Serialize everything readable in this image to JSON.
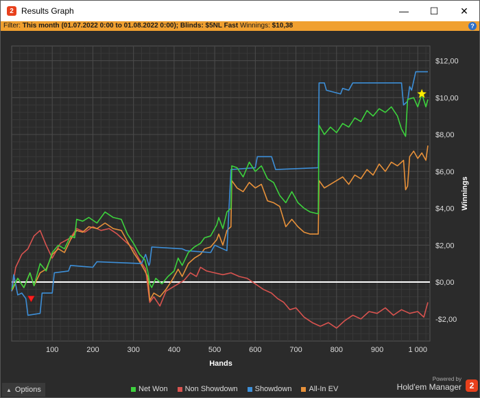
{
  "window": {
    "title": "Results Graph",
    "app_badge": "2",
    "controls": {
      "minimize": "—",
      "maximize": "☐",
      "close": "✕"
    }
  },
  "filter": {
    "prefix": "Filter: ",
    "period": "This month (01.07.2022 0:00 to 01.08.2022 0:00)",
    "sep1": "; ",
    "blinds": "Blinds: $5NL Fast",
    "sep2": " Winnings: ",
    "winnings": "$10,38",
    "help": "?"
  },
  "footer": {
    "options_label": "Options",
    "powered_by": "Powered by",
    "brand": "Hold'em Manager",
    "brand_badge": "2"
  },
  "chart_data": {
    "type": "line",
    "xlabel": "Hands",
    "ylabel": "Winnings",
    "xlim": [
      0,
      1030
    ],
    "ylim": [
      -3.2,
      12.8
    ],
    "x_ticks": [
      100,
      200,
      300,
      400,
      500,
      600,
      700,
      800,
      900,
      1000
    ],
    "x_tick_labels": [
      "100",
      "200",
      "300",
      "400",
      "500",
      "600",
      "700",
      "800",
      "900",
      "1 000"
    ],
    "y_ticks": [
      -2,
      0,
      2,
      4,
      6,
      8,
      10,
      12
    ],
    "y_tick_labels": [
      "-$2,00",
      "$0,00",
      "$2,00",
      "$4,00",
      "$6,00",
      "$8,00",
      "$10,00",
      "$12,00"
    ],
    "grid": true,
    "zero_line": true,
    "legend": {
      "placement": "bottom"
    },
    "markers": [
      {
        "name": "min",
        "x": 48,
        "y": -0.9,
        "shape": "triangle-down",
        "color": "#ff2020"
      },
      {
        "name": "max",
        "x": 1010,
        "y": 10.2,
        "shape": "star",
        "color": "#ffee00"
      }
    ],
    "series": [
      {
        "name": "Net Won",
        "color": "#3dd23d",
        "points": [
          [
            0,
            -0.4
          ],
          [
            15,
            0.2
          ],
          [
            30,
            -0.3
          ],
          [
            45,
            0.5
          ],
          [
            55,
            -0.2
          ],
          [
            70,
            1.0
          ],
          [
            85,
            0.6
          ],
          [
            100,
            1.6
          ],
          [
            115,
            2.0
          ],
          [
            130,
            1.8
          ],
          [
            145,
            2.5
          ],
          [
            155,
            2.4
          ],
          [
            160,
            3.4
          ],
          [
            175,
            3.3
          ],
          [
            190,
            3.5
          ],
          [
            210,
            3.2
          ],
          [
            230,
            3.8
          ],
          [
            250,
            3.5
          ],
          [
            270,
            3.4
          ],
          [
            285,
            2.6
          ],
          [
            300,
            2.1
          ],
          [
            315,
            1.5
          ],
          [
            328,
            1.2
          ],
          [
            335,
            0.6
          ],
          [
            340,
            -0.1
          ],
          [
            345,
            -0.3
          ],
          [
            355,
            0.2
          ],
          [
            370,
            -0.1
          ],
          [
            385,
            0.3
          ],
          [
            400,
            0.6
          ],
          [
            410,
            1.3
          ],
          [
            420,
            0.9
          ],
          [
            435,
            1.6
          ],
          [
            450,
            1.9
          ],
          [
            465,
            2.1
          ],
          [
            475,
            2.4
          ],
          [
            490,
            2.5
          ],
          [
            505,
            3.1
          ],
          [
            510,
            3.5
          ],
          [
            520,
            2.9
          ],
          [
            530,
            3.8
          ],
          [
            540,
            4.0
          ],
          [
            542,
            6.3
          ],
          [
            555,
            6.2
          ],
          [
            570,
            5.7
          ],
          [
            585,
            6.5
          ],
          [
            600,
            6.0
          ],
          [
            615,
            6.3
          ],
          [
            630,
            5.6
          ],
          [
            645,
            5.4
          ],
          [
            660,
            4.7
          ],
          [
            675,
            4.3
          ],
          [
            690,
            4.9
          ],
          [
            705,
            4.3
          ],
          [
            720,
            4.0
          ],
          [
            735,
            3.8
          ],
          [
            755,
            3.7
          ],
          [
            757,
            8.5
          ],
          [
            770,
            8.0
          ],
          [
            785,
            8.4
          ],
          [
            800,
            8.1
          ],
          [
            815,
            8.6
          ],
          [
            830,
            8.4
          ],
          [
            845,
            8.9
          ],
          [
            860,
            8.7
          ],
          [
            875,
            9.3
          ],
          [
            890,
            9.0
          ],
          [
            905,
            9.4
          ],
          [
            920,
            9.2
          ],
          [
            935,
            9.5
          ],
          [
            950,
            9.0
          ],
          [
            960,
            8.3
          ],
          [
            970,
            7.9
          ],
          [
            975,
            9.9
          ],
          [
            990,
            10.0
          ],
          [
            1000,
            9.5
          ],
          [
            1010,
            10.2
          ],
          [
            1020,
            9.5
          ],
          [
            1025,
            9.9
          ]
        ]
      },
      {
        "name": "Non Showdown",
        "color": "#d9534f",
        "points": [
          [
            0,
            -0.5
          ],
          [
            10,
            0.8
          ],
          [
            25,
            1.5
          ],
          [
            40,
            1.8
          ],
          [
            55,
            2.5
          ],
          [
            70,
            2.8
          ],
          [
            85,
            2.0
          ],
          [
            100,
            1.3
          ],
          [
            120,
            2.1
          ],
          [
            145,
            2.4
          ],
          [
            160,
            2.9
          ],
          [
            180,
            2.7
          ],
          [
            200,
            3.0
          ],
          [
            220,
            2.8
          ],
          [
            240,
            2.9
          ],
          [
            260,
            2.6
          ],
          [
            280,
            2.2
          ],
          [
            300,
            1.8
          ],
          [
            315,
            1.2
          ],
          [
            330,
            0.7
          ],
          [
            340,
            -1.1
          ],
          [
            350,
            -0.8
          ],
          [
            365,
            -1.3
          ],
          [
            380,
            -0.5
          ],
          [
            395,
            -0.3
          ],
          [
            410,
            -0.1
          ],
          [
            425,
            0.1
          ],
          [
            440,
            0.5
          ],
          [
            455,
            0.3
          ],
          [
            465,
            0.8
          ],
          [
            480,
            0.6
          ],
          [
            500,
            0.5
          ],
          [
            520,
            0.4
          ],
          [
            540,
            0.5
          ],
          [
            560,
            0.3
          ],
          [
            580,
            0.2
          ],
          [
            600,
            -0.1
          ],
          [
            620,
            -0.4
          ],
          [
            640,
            -0.6
          ],
          [
            655,
            -0.9
          ],
          [
            670,
            -1.1
          ],
          [
            685,
            -1.5
          ],
          [
            700,
            -1.4
          ],
          [
            720,
            -1.9
          ],
          [
            740,
            -2.2
          ],
          [
            760,
            -2.4
          ],
          [
            780,
            -2.2
          ],
          [
            800,
            -2.5
          ],
          [
            820,
            -2.1
          ],
          [
            840,
            -1.8
          ],
          [
            860,
            -2.0
          ],
          [
            880,
            -1.6
          ],
          [
            900,
            -1.7
          ],
          [
            920,
            -1.4
          ],
          [
            940,
            -1.8
          ],
          [
            960,
            -1.5
          ],
          [
            980,
            -1.7
          ],
          [
            1000,
            -1.6
          ],
          [
            1015,
            -1.9
          ],
          [
            1025,
            -1.1
          ]
        ]
      },
      {
        "name": "Showdown",
        "color": "#3d8fd8",
        "points": [
          [
            0,
            -0.5
          ],
          [
            5,
            0.4
          ],
          [
            15,
            -0.7
          ],
          [
            25,
            -0.6
          ],
          [
            35,
            -0.9
          ],
          [
            40,
            -1.8
          ],
          [
            70,
            -1.7
          ],
          [
            75,
            -0.6
          ],
          [
            100,
            -0.6
          ],
          [
            105,
            0.5
          ],
          [
            140,
            0.6
          ],
          [
            145,
            0.9
          ],
          [
            200,
            0.8
          ],
          [
            210,
            1.1
          ],
          [
            320,
            1.0
          ],
          [
            330,
            1.5
          ],
          [
            338,
            0.9
          ],
          [
            340,
            1.0
          ],
          [
            345,
            1.9
          ],
          [
            420,
            1.8
          ],
          [
            430,
            1.7
          ],
          [
            490,
            1.6
          ],
          [
            500,
            2.0
          ],
          [
            530,
            1.7
          ],
          [
            540,
            6.1
          ],
          [
            600,
            6.2
          ],
          [
            605,
            6.8
          ],
          [
            640,
            6.8
          ],
          [
            650,
            6.1
          ],
          [
            755,
            6.2
          ],
          [
            757,
            10.8
          ],
          [
            770,
            10.8
          ],
          [
            775,
            10.4
          ],
          [
            810,
            10.2
          ],
          [
            815,
            10.5
          ],
          [
            830,
            10.4
          ],
          [
            840,
            10.8
          ],
          [
            960,
            10.8
          ],
          [
            965,
            9.6
          ],
          [
            975,
            9.8
          ],
          [
            980,
            10.6
          ],
          [
            985,
            10.4
          ],
          [
            995,
            11.4
          ],
          [
            1025,
            11.4
          ]
        ]
      },
      {
        "name": "All-In EV",
        "color": "#e8913a",
        "points": [
          [
            0,
            -0.5
          ],
          [
            15,
            0.2
          ],
          [
            30,
            -0.3
          ],
          [
            45,
            0.5
          ],
          [
            55,
            -0.2
          ],
          [
            70,
            0.5
          ],
          [
            85,
            0.7
          ],
          [
            100,
            1.5
          ],
          [
            115,
            1.8
          ],
          [
            130,
            1.6
          ],
          [
            145,
            2.3
          ],
          [
            160,
            2.8
          ],
          [
            175,
            2.7
          ],
          [
            190,
            3.0
          ],
          [
            210,
            2.9
          ],
          [
            230,
            3.2
          ],
          [
            250,
            2.9
          ],
          [
            270,
            2.8
          ],
          [
            285,
            2.2
          ],
          [
            300,
            1.6
          ],
          [
            315,
            1.1
          ],
          [
            328,
            0.6
          ],
          [
            335,
            0.3
          ],
          [
            340,
            -1.0
          ],
          [
            350,
            -0.6
          ],
          [
            365,
            -0.8
          ],
          [
            380,
            -0.4
          ],
          [
            395,
            0.1
          ],
          [
            410,
            0.7
          ],
          [
            420,
            0.3
          ],
          [
            435,
            1.0
          ],
          [
            450,
            1.3
          ],
          [
            465,
            1.5
          ],
          [
            475,
            1.8
          ],
          [
            490,
            1.9
          ],
          [
            505,
            2.3
          ],
          [
            510,
            2.6
          ],
          [
            520,
            2.0
          ],
          [
            530,
            2.8
          ],
          [
            540,
            3.0
          ],
          [
            542,
            5.5
          ],
          [
            555,
            5.1
          ],
          [
            570,
            4.9
          ],
          [
            585,
            5.4
          ],
          [
            600,
            5.1
          ],
          [
            615,
            5.3
          ],
          [
            630,
            4.4
          ],
          [
            645,
            4.3
          ],
          [
            660,
            4.1
          ],
          [
            675,
            3.0
          ],
          [
            690,
            3.4
          ],
          [
            705,
            3.0
          ],
          [
            720,
            2.7
          ],
          [
            735,
            2.6
          ],
          [
            755,
            2.6
          ],
          [
            757,
            5.5
          ],
          [
            770,
            5.1
          ],
          [
            785,
            5.3
          ],
          [
            800,
            5.5
          ],
          [
            815,
            5.7
          ],
          [
            830,
            5.3
          ],
          [
            845,
            5.8
          ],
          [
            860,
            5.6
          ],
          [
            875,
            6.1
          ],
          [
            890,
            5.8
          ],
          [
            905,
            6.4
          ],
          [
            920,
            6.0
          ],
          [
            935,
            6.5
          ],
          [
            950,
            6.3
          ],
          [
            965,
            6.6
          ],
          [
            970,
            5.0
          ],
          [
            975,
            5.2
          ],
          [
            980,
            6.8
          ],
          [
            990,
            7.1
          ],
          [
            1000,
            6.7
          ],
          [
            1010,
            7.0
          ],
          [
            1020,
            6.6
          ],
          [
            1025,
            7.4
          ]
        ]
      }
    ]
  }
}
